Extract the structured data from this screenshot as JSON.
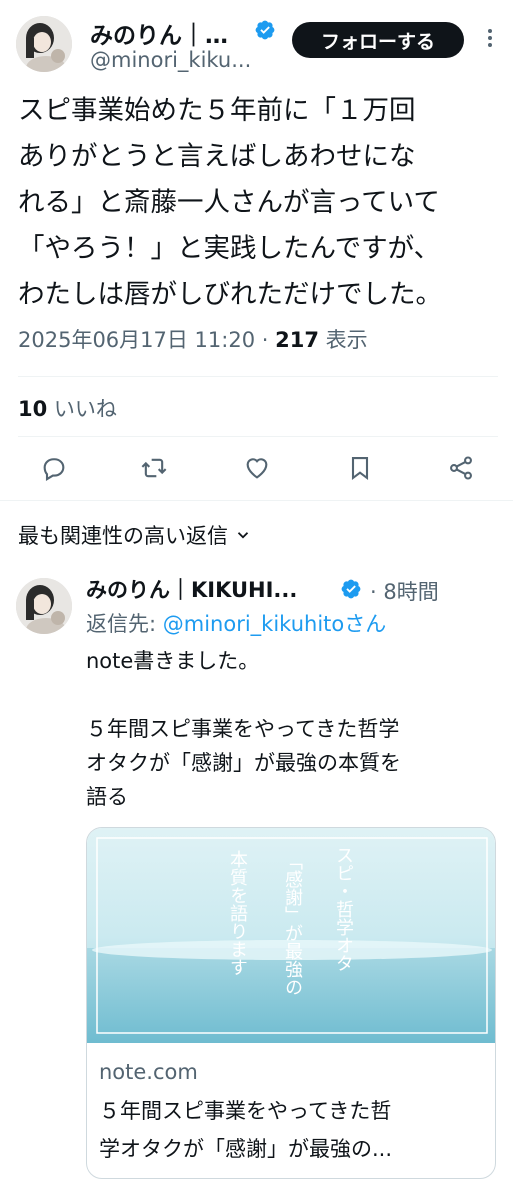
{
  "tweet": {
    "author_name": "みのりん｜…",
    "author_handle": "@minori_kiku...",
    "follow_label": "フォローする",
    "body_lines": [
      "スピ事業始めた５年前に「１万回",
      "ありがとうと言えばしあわせにな",
      "れる」と斎藤一人さんが言っていて",
      "「やろう！」と実践したんですが、",
      "わたしは唇がしびれただけでした。"
    ],
    "timestamp": "2025年06月17日 11:20",
    "separator": " · ",
    "views_count": "217",
    "views_label": " 表示",
    "likes_count": "10",
    "likes_label": " いいね"
  },
  "replies_section": {
    "sort_label": "最も関連性の高い返信"
  },
  "reply": {
    "author_name": "みのりん｜KIKUHI...",
    "time": "· 8時間",
    "reply_to_prefix": "返信先: ",
    "reply_to_handle": "@minori_kikuhitoさん",
    "body_lines": [
      "note書きました。",
      "",
      "５年間スピ事業をやってきた哲学",
      "オタクが「感謝」が最強の本質を",
      "語る"
    ],
    "card": {
      "image_text_col1": "スピ・哲学オタ",
      "image_text_col2": "「感謝」が最強の",
      "image_text_col3": "本質を語ります",
      "domain": "note.com",
      "title_lines": [
        "５年間スピ事業をやってきた哲",
        "学オタクが「感謝」が最強の..."
      ]
    }
  },
  "colors": {
    "verified": "#1d9bf0",
    "text_secondary": "#536471",
    "accent": "#1d9bf0"
  },
  "icons": [
    "verified-badge-icon",
    "more-icon",
    "reply-icon",
    "retweet-icon",
    "like-icon",
    "bookmark-icon",
    "share-icon",
    "chevron-down-icon"
  ]
}
